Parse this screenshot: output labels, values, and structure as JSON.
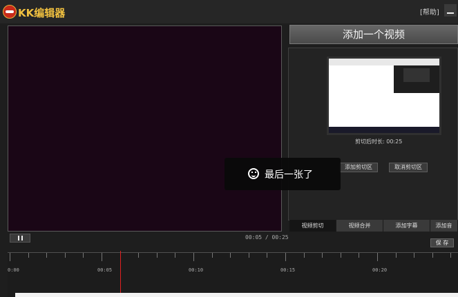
{
  "app": {
    "title": "KK编辑器",
    "help": "[帮助]"
  },
  "preview": {
    "timecode": "00:05 / 00:25"
  },
  "right_panel": {
    "add_video": "添加一个视频",
    "clip_length_label": "剪切后时长: 00:25",
    "add_clip_region": "添加剪切区",
    "cancel_clip_region": "取消剪切区"
  },
  "tabs": [
    "视频剪切",
    "视频合并",
    "添加字幕",
    "添加音"
  ],
  "save": "保 存",
  "timeline": {
    "labels": [
      "0:00",
      "00:05",
      "00:10",
      "00:15",
      "00:20"
    ]
  },
  "toast": {
    "message": "最后一张了"
  },
  "colors": {
    "accent": "#f0c040",
    "playhead": "#e02020",
    "preview_bg": "#1a0616"
  }
}
